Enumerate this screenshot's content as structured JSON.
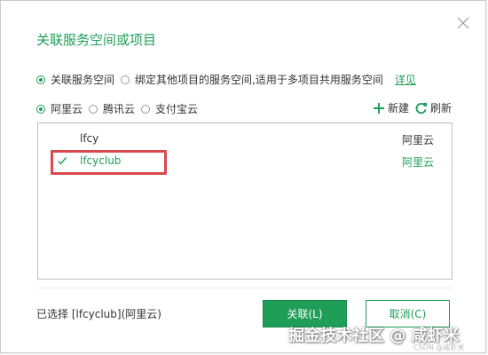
{
  "dialog": {
    "title": "关联服务空间或项目"
  },
  "mode_options": [
    {
      "label": "关联服务空间",
      "selected": true
    },
    {
      "label": "绑定其他项目的服务空间,适用于多项目共用服务空间",
      "selected": false
    }
  ],
  "mode_link": "详见",
  "provider_options": [
    {
      "label": "阿里云",
      "selected": true
    },
    {
      "label": "腾讯云",
      "selected": false
    },
    {
      "label": "支付宝云",
      "selected": false
    }
  ],
  "actions": {
    "new_label": "新建",
    "refresh_label": "刷新"
  },
  "spaces": [
    {
      "name": "lfcy",
      "provider": "阿里云",
      "selected": false
    },
    {
      "name": "lfcyclub",
      "provider": "阿里云",
      "selected": true
    }
  ],
  "footer": {
    "selection_text": "已选择 [lfcyclub](阿里云)",
    "ok_label": "关联(L)",
    "cancel_label": "取消(C)"
  },
  "watermark": {
    "text": "掘金技术社区 @ 咸虾米",
    "small": "CSDN @咸虾米"
  },
  "colors": {
    "accent": "#1f9e58",
    "highlight": "#d9484d"
  }
}
